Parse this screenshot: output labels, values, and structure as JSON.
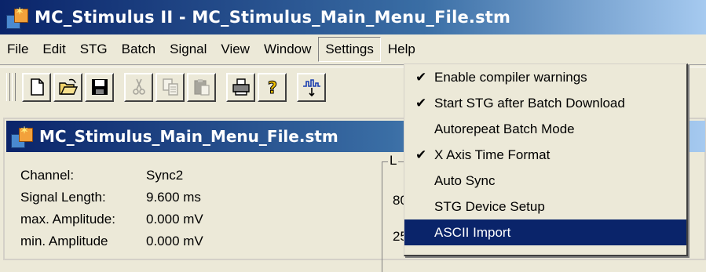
{
  "window": {
    "title": "MC_Stimulus II - MC_Stimulus_Main_Menu_File.stm"
  },
  "menubar": {
    "items": [
      "File",
      "Edit",
      "STG",
      "Batch",
      "Signal",
      "View",
      "Window",
      "Settings",
      "Help"
    ],
    "active": "Settings"
  },
  "toolbar": {
    "buttons": [
      "new-file-icon",
      "open-folder-icon",
      "save-disk-icon",
      "cut-scissors-icon",
      "copy-icon",
      "paste-icon",
      "print-icon",
      "help-question-icon",
      "signal-icon"
    ]
  },
  "child_window": {
    "title": "MC_Stimulus_Main_Menu_File.stm",
    "info": [
      {
        "label": "Channel:",
        "value": "Sync2"
      },
      {
        "label": "Signal Length:",
        "value": "9.600 ms"
      },
      {
        "label": "max. Amplitude:",
        "value": "0.000 mV"
      },
      {
        "label": "min. Amplitude",
        "value": "0.000 mV"
      }
    ],
    "groupbox_label": "L",
    "groupbox_values": [
      "80",
      "25"
    ]
  },
  "settings_menu": {
    "items": [
      {
        "label": "Enable compiler warnings",
        "checked": true,
        "highlighted": false
      },
      {
        "label": "Start STG after Batch Download",
        "checked": true,
        "highlighted": false
      },
      {
        "label": "Autorepeat Batch Mode",
        "checked": false,
        "highlighted": false
      },
      {
        "label": "X Axis Time Format",
        "checked": true,
        "highlighted": false
      },
      {
        "label": "Auto Sync",
        "checked": false,
        "highlighted": false
      },
      {
        "label": "STG Device Setup",
        "checked": false,
        "highlighted": false
      },
      {
        "label": "ASCII Import",
        "checked": false,
        "highlighted": true
      }
    ],
    "check_glyph": "✔"
  },
  "colors": {
    "title_dark": "#0a246a",
    "title_light": "#a6caf0",
    "face": "#ece9d8",
    "highlight": "#0a246a"
  }
}
